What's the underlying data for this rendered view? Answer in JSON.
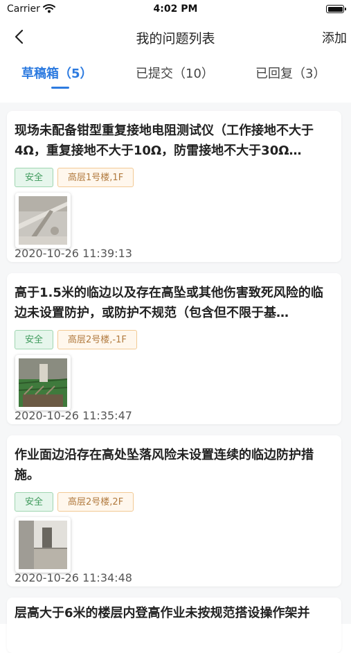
{
  "status": {
    "carrier": "Carrier",
    "time": "4:02 PM"
  },
  "nav": {
    "title": "我的问题列表",
    "add_label": "添加"
  },
  "tabs": [
    {
      "label": "草稿箱（5）",
      "active": true
    },
    {
      "label": "已提交（10）",
      "active": false
    },
    {
      "label": "已回复（3）",
      "active": false
    }
  ],
  "issues": [
    {
      "title": "现场未配备钳型重复接地电阻测试仪（工作接地不大于4Ω，重复接地不大于10Ω，防雷接地不大于30Ω…",
      "category": "安全",
      "location": "高层1号楼,1F",
      "time": "2020-10-26 11:39:13"
    },
    {
      "title": "高于1.5米的临边以及存在高坠或其他伤害致死风险的临边未设置防护，或防护不规范（包含但不限于基…",
      "category": "安全",
      "location": "高层2号楼,-1F",
      "time": "2020-10-26 11:35:47"
    },
    {
      "title": "作业面边沿存在高处坠落风险未设置连续的临边防护措施。",
      "category": "安全",
      "location": "高层2号楼,2F",
      "time": "2020-10-26 11:34:48"
    },
    {
      "title": "层高大于6米的楼层内登高作业未按规范搭设操作架并"
    }
  ],
  "colors": {
    "accent": "#2d7be0",
    "tag_safe": "#3e9a5b",
    "tag_location": "#b17a3e"
  }
}
